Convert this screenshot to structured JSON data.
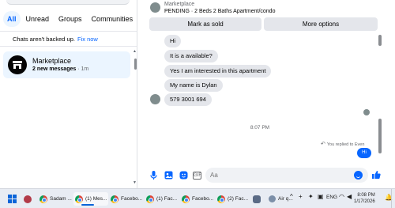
{
  "left": {
    "filters": [
      {
        "label": "All",
        "active": true
      },
      {
        "label": "Unread",
        "active": false
      },
      {
        "label": "Groups",
        "active": false
      },
      {
        "label": "Communities",
        "active": false
      }
    ],
    "backup_text": "Chats aren't backed up.",
    "backup_link": "Fix now",
    "conversation": {
      "name": "Marketplace",
      "new_messages": "2 new messages",
      "time": " · 1m"
    }
  },
  "header": {
    "title": "Marketplace",
    "subtitle": "PENDING · 2 Beds 2 Baths Apartment/condo",
    "mark_sold_label": "Mark as sold",
    "more_options_label": "More options"
  },
  "messages": [
    "Hi",
    "It is a available?",
    "Yes I am interested in this apartment",
    "My name is Dylan",
    "579 3001 694"
  ],
  "timestamp": "8:07 PM",
  "replied_text": "You replied to Even",
  "outgoing_message": "Hi",
  "composer": {
    "placeholder": "Aa",
    "icons": [
      "microphone-icon",
      "image-icon",
      "sticker-icon",
      "gif-icon",
      "emoji-icon",
      "like-icon"
    ]
  },
  "colors": {
    "accent": "#0866ff",
    "bubble_gray": "#e4e6eb",
    "taskbar_bg": "#e8ecf3"
  },
  "taskbar": {
    "apps": [
      {
        "label": "Sadam ..."
      },
      {
        "label": "(1) Mes..."
      },
      {
        "label": "Facebo..."
      },
      {
        "label": "(1) Fac..."
      },
      {
        "label": "Facebo..."
      },
      {
        "label": "(2) Fac..."
      }
    ],
    "weather": "Air q...",
    "lang": "ENG",
    "time": "8:08 PM",
    "date": "1/17/2026"
  }
}
